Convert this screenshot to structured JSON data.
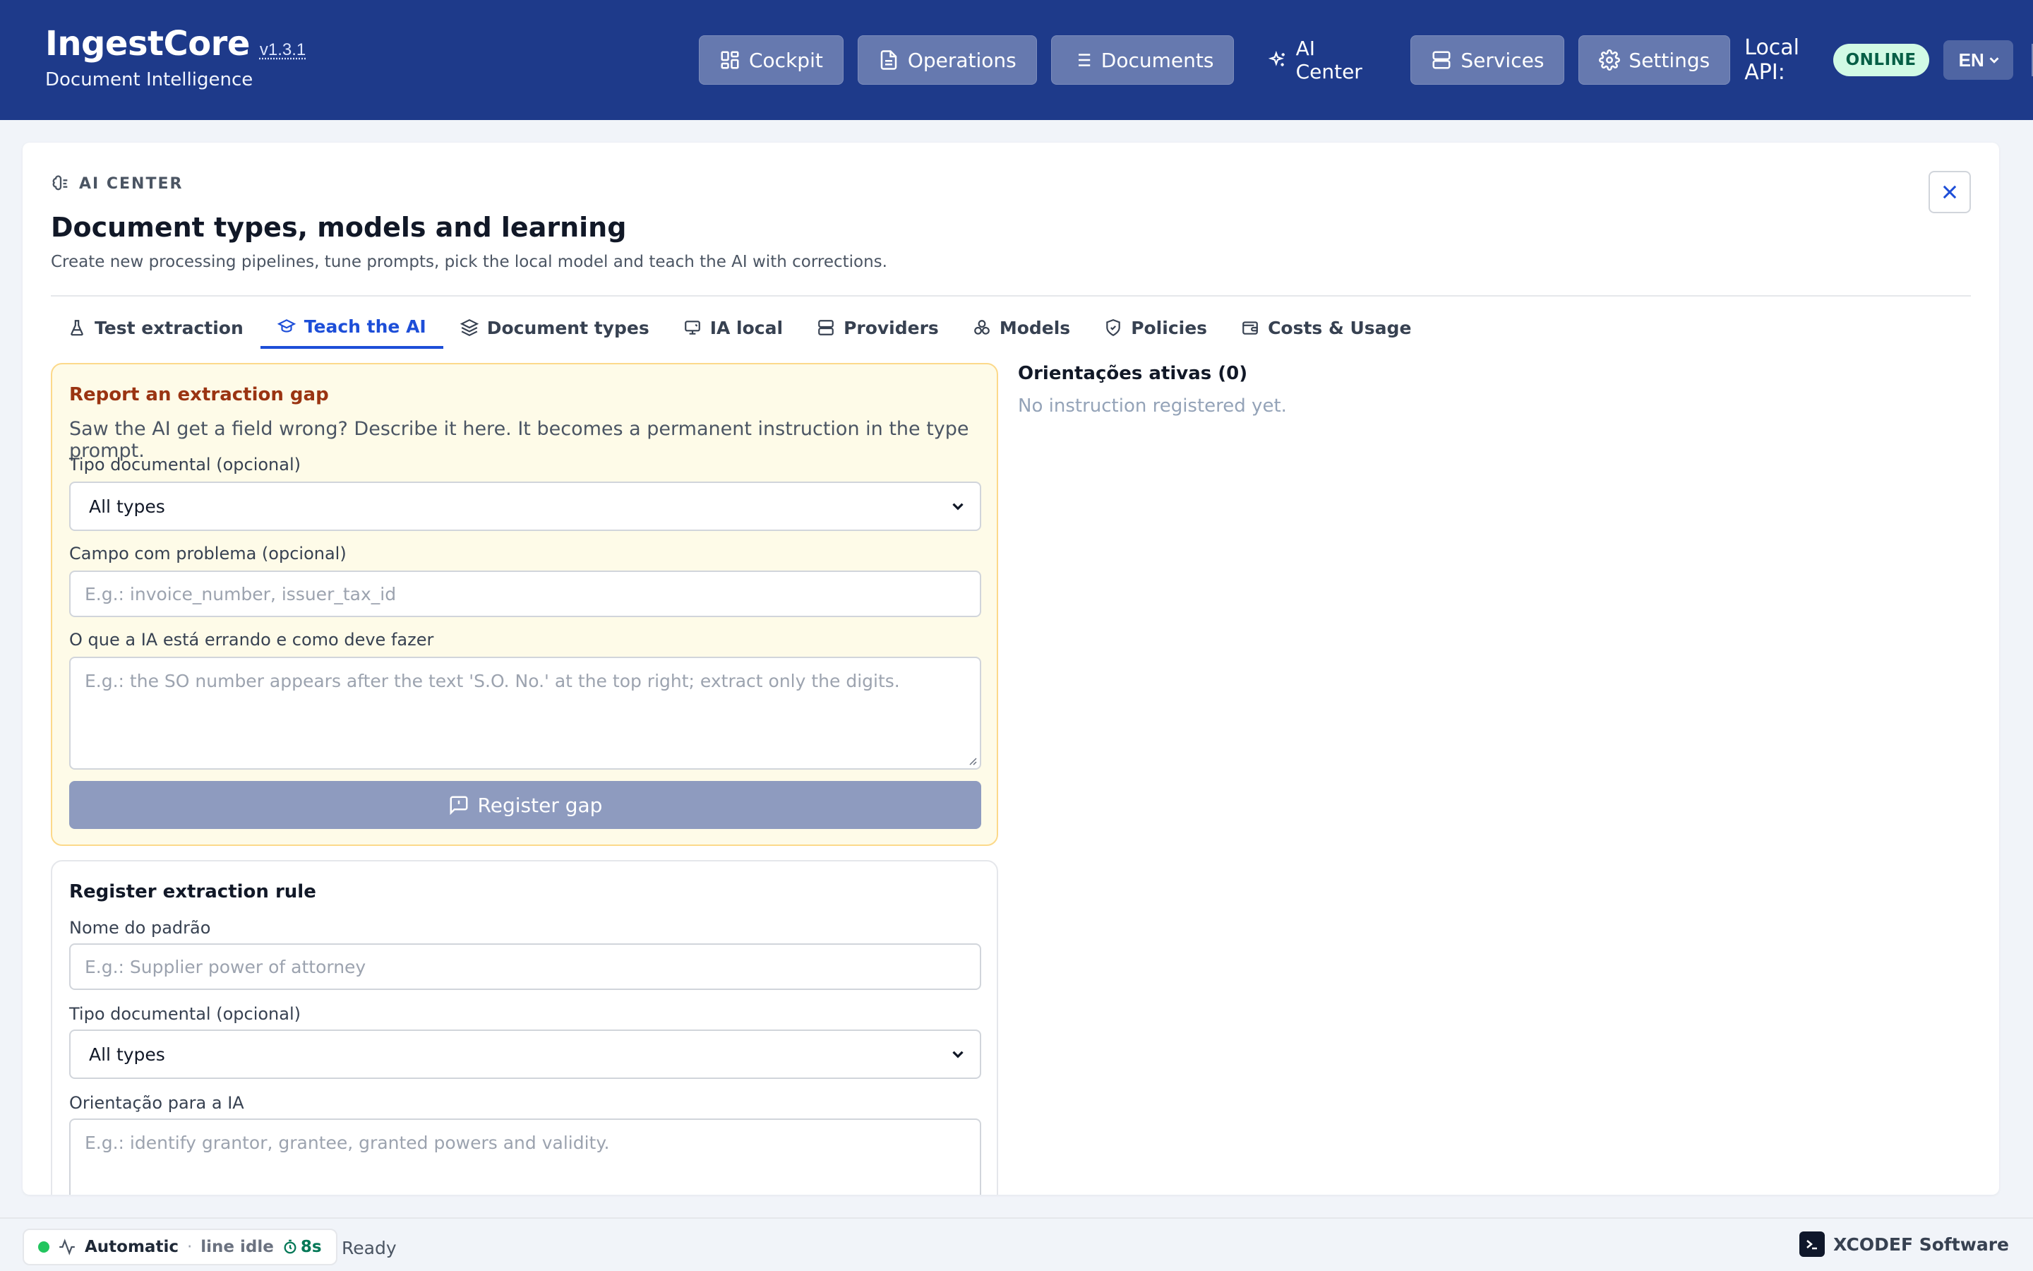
{
  "app": {
    "name": "IngestCore",
    "version": "v1.3.1",
    "subtitle": "Document Intelligence"
  },
  "nav": {
    "items": [
      {
        "label": "Cockpit",
        "icon": "dashboard-icon"
      },
      {
        "label": "Operations",
        "icon": "file-text-icon"
      },
      {
        "label": "Documents",
        "icon": "list-icon"
      },
      {
        "label": "AI Center",
        "icon": "sparkles-icon",
        "active": true
      },
      {
        "label": "Services",
        "icon": "server-icon"
      },
      {
        "label": "Settings",
        "icon": "gear-icon"
      }
    ],
    "api_label": "Local API:",
    "api_status": "ONLINE",
    "language": "EN"
  },
  "page": {
    "eyebrow": "AI CENTER",
    "title": "Document types, models and learning",
    "description": "Create new processing pipelines, tune prompts, pick the local model and teach the AI with corrections."
  },
  "tabs": [
    {
      "label": "Test extraction",
      "icon": "flask-icon"
    },
    {
      "label": "Teach the AI",
      "icon": "graduation-cap-icon",
      "active": true
    },
    {
      "label": "Document types",
      "icon": "layers-icon"
    },
    {
      "label": "IA local",
      "icon": "monitor-icon"
    },
    {
      "label": "Providers",
      "icon": "server-icon"
    },
    {
      "label": "Models",
      "icon": "boxes-icon"
    },
    {
      "label": "Policies",
      "icon": "shield-icon"
    },
    {
      "label": "Costs & Usage",
      "icon": "wallet-icon"
    }
  ],
  "gap_form": {
    "title": "Report an extraction gap",
    "description": "Saw the AI get a field wrong? Describe it here. It becomes a permanent instruction in the type prompt.",
    "doc_type_label": "Tipo documental (opcional)",
    "doc_type_value": "All types",
    "field_label": "Campo com problema (opcional)",
    "field_placeholder": "E.g.: invoice_number, issuer_tax_id",
    "issue_label": "O que a IA está errando e como deve fazer",
    "issue_placeholder": "E.g.: the SO number appears after the text 'S.O. No.' at the top right; extract only the digits.",
    "submit_label": "Register gap"
  },
  "rule_form": {
    "title": "Register extraction rule",
    "pattern_label": "Nome do padrão",
    "pattern_placeholder": "E.g.: Supplier power of attorney",
    "doc_type_label": "Tipo documental (opcional)",
    "doc_type_value": "All types",
    "guidance_label": "Orientação para a IA",
    "guidance_placeholder": "E.g.: identify grantor, grantee, granted powers and validity."
  },
  "instructions": {
    "title": "Orientações ativas (0)",
    "empty": "No instruction registered yet."
  },
  "status": {
    "mode": "Automatic",
    "separator": "·",
    "line_state": "line idle",
    "timer": "8s",
    "message": "Ready",
    "company": "XCODEF Software"
  },
  "colors": {
    "header_bg": "#1e3a8a",
    "accent": "#1d4ed8",
    "gap_card_bg": "#fefbe8",
    "gap_title": "#9a3412",
    "online_bg": "#d1fae5",
    "status_ok": "#22c55e"
  }
}
